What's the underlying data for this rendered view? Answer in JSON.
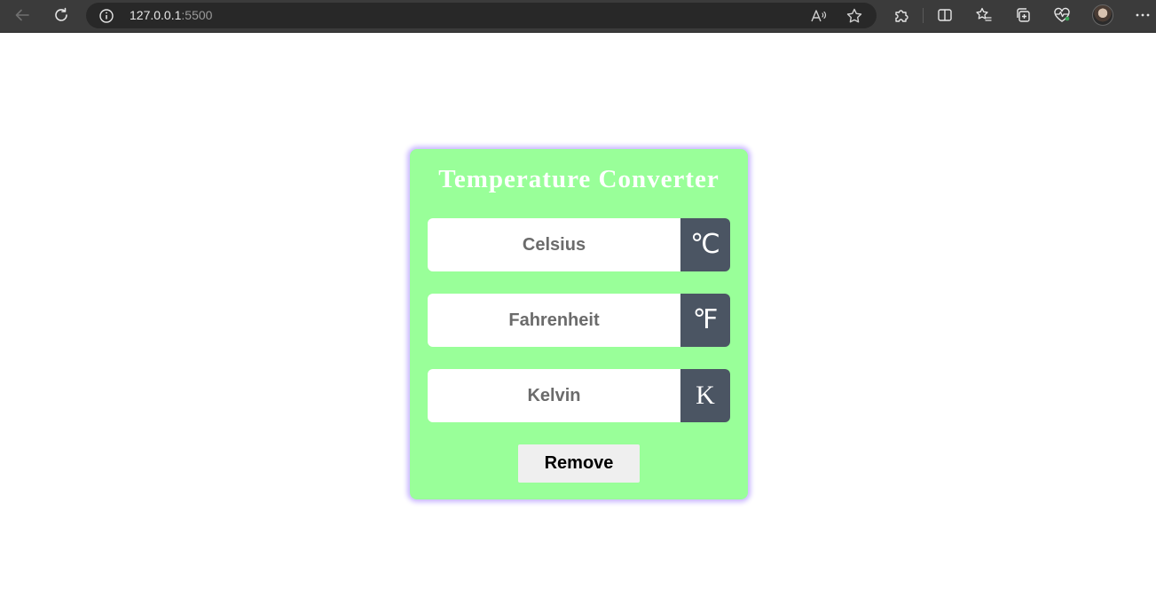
{
  "browser": {
    "url_host": "127.0.0.1",
    "url_port": ":5500",
    "icons": {
      "back": "back-arrow-icon",
      "refresh": "refresh-icon",
      "info": "info-icon",
      "read_aloud": "read-aloud-icon",
      "favorite": "star-icon",
      "extensions": "puzzle-icon",
      "split_screen": "split-screen-icon",
      "favorites": "favorites-list-icon",
      "collections": "collections-icon",
      "browser_essentials": "heart-pulse-icon",
      "profile": "avatar",
      "more": "more-icon"
    }
  },
  "converter": {
    "title": "Temperature Converter",
    "rows": [
      {
        "placeholder": "Celsius",
        "unit": "℃"
      },
      {
        "placeholder": "Fahrenheit",
        "unit": "℉"
      },
      {
        "placeholder": "Kelvin",
        "unit": "K"
      }
    ],
    "remove_label": "Remove"
  },
  "colors": {
    "card_background": "#99ff99",
    "card_glow": "#c9b7ff",
    "unit_background": "#4b5563",
    "toolbar": "#3b3b3b"
  }
}
